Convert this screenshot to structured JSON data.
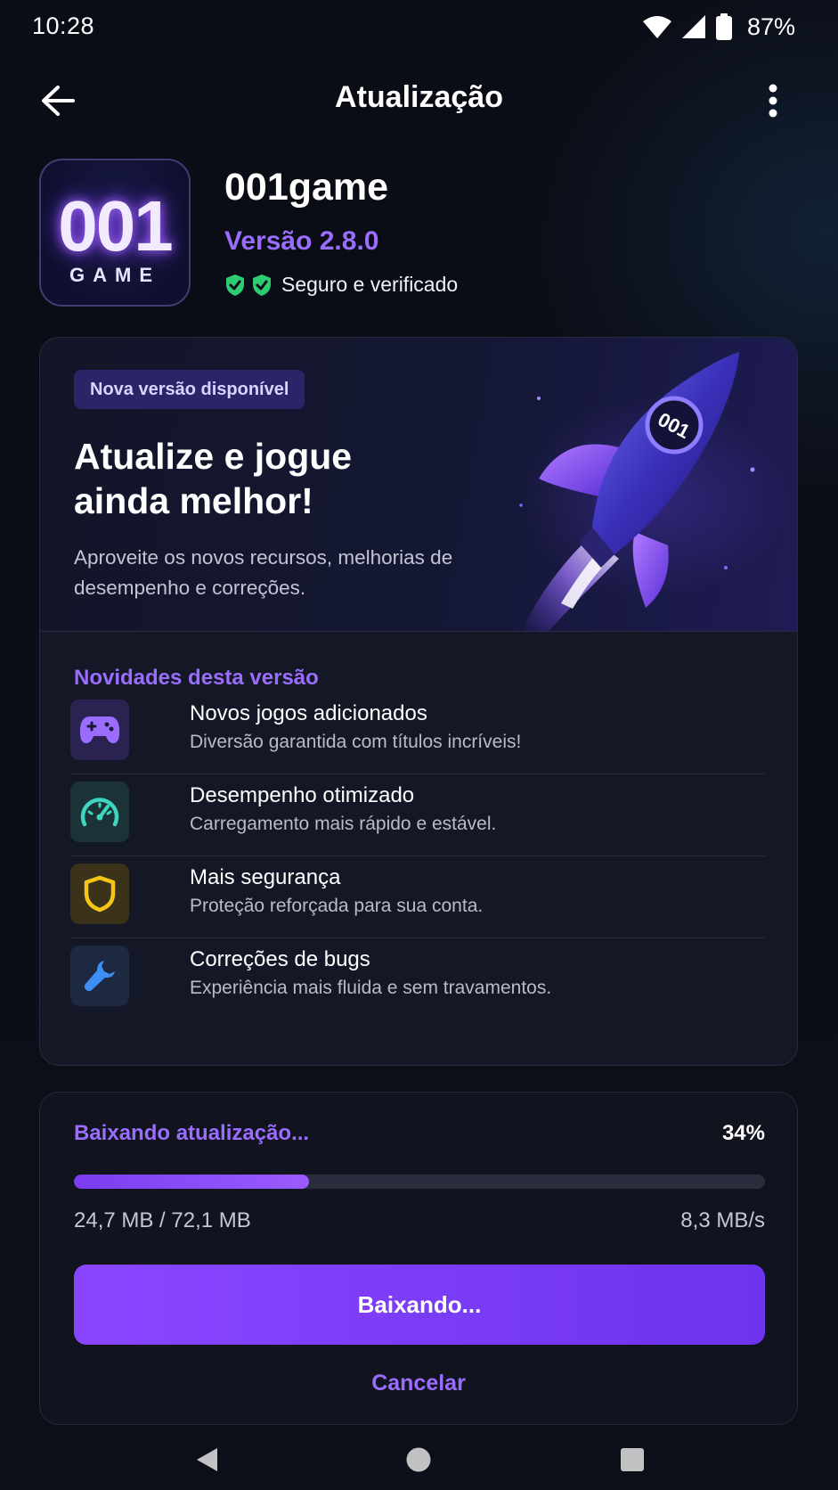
{
  "status_bar": {
    "time": "10:28",
    "battery_percent": "87%",
    "icons": [
      "wifi-icon",
      "cellular-signal-icon",
      "battery-icon"
    ]
  },
  "header": {
    "title": "Atualização",
    "back_icon": "arrow-left-icon",
    "menu_icon": "more-vertical-icon"
  },
  "app": {
    "icon_number": "001",
    "icon_word": "GAME",
    "name": "001game",
    "version": "Versão 2.8.0",
    "verified_text": "Seguro e verificado"
  },
  "hero": {
    "badge": "Nova versão disponível",
    "title_line1": "Atualize e jogue",
    "title_line2": "ainda melhor!",
    "description": "Aproveite os novos recursos, melhorias de desempenho e correções.",
    "rocket_label": "001"
  },
  "whats_new": {
    "title": "Novidades desta versão",
    "items": [
      {
        "icon": "gamepad-icon",
        "title": "Novos jogos adicionados",
        "subtitle": "Diversão garantida com títulos incríveis!",
        "color": "#9b6dff"
      },
      {
        "icon": "speedometer-icon",
        "title": "Desempenho otimizado",
        "subtitle": "Carregamento mais rápido e estável.",
        "color": "#3ed6c0"
      },
      {
        "icon": "shield-icon",
        "title": "Mais segurança",
        "subtitle": "Proteção reforçada para sua conta.",
        "color": "#f5c518"
      },
      {
        "icon": "wrench-icon",
        "title": "Correções de bugs",
        "subtitle": "Experiência mais fluida e sem travamentos.",
        "color": "#3d8ef5"
      }
    ]
  },
  "download": {
    "label": "Baixando atualização...",
    "percent": "34%",
    "progress": 0.34,
    "size": "24,7 MB / 72,1 MB",
    "speed": "8,3 MB/s",
    "button_label": "Baixando...",
    "cancel_label": "Cancelar"
  },
  "colors": {
    "accent": "#9b6dff",
    "background": "#0b0d16",
    "card": "#141726",
    "verified_green": "#2ecc71"
  }
}
